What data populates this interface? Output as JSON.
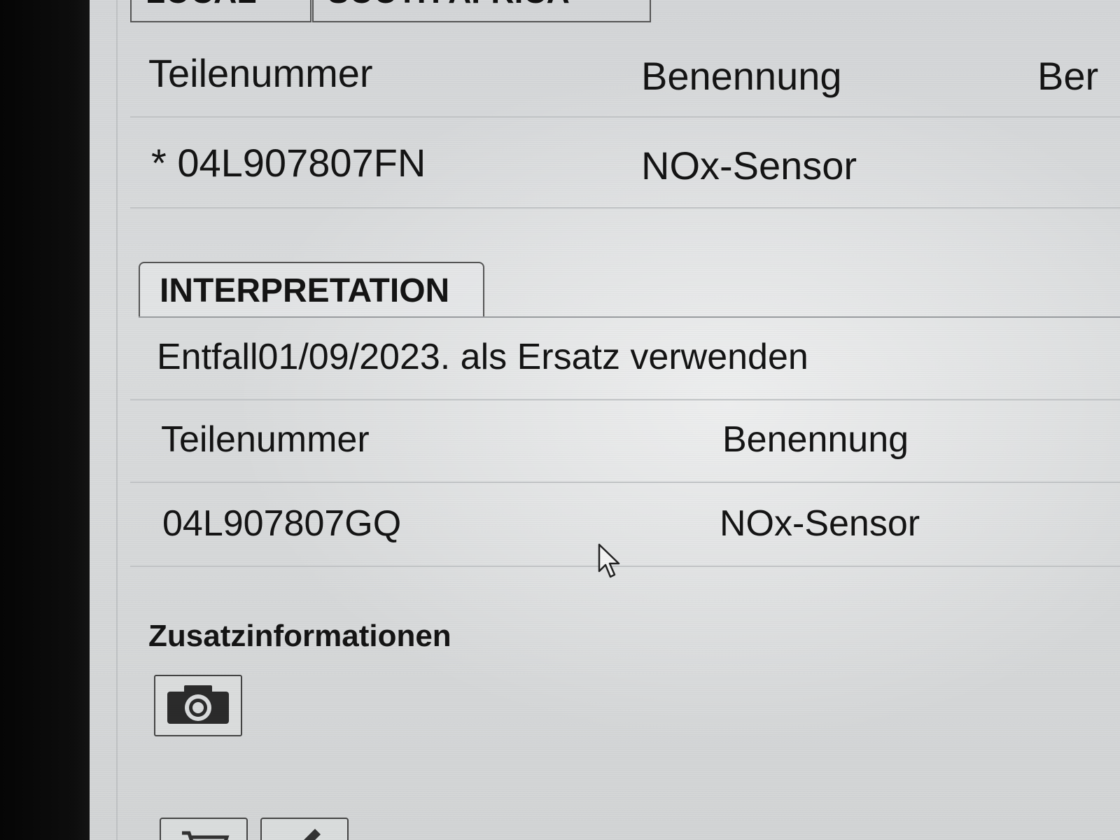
{
  "top_tabs": [
    {
      "label": "LOCAL"
    },
    {
      "label": "SOUTH AFRICA"
    }
  ],
  "parts_table": {
    "headers": [
      "Teilenummer",
      "Benennung",
      "Ber"
    ],
    "rows": [
      {
        "part_number": "* 04L907807FN",
        "name": "NOx-Sensor"
      }
    ]
  },
  "interpretation": {
    "tab_label": "INTERPRETATION",
    "note": "Entfall01/09/2023. als Ersatz verwenden",
    "headers": [
      "Teilenummer",
      "Benennung"
    ],
    "rows": [
      {
        "part_number": "04L907807GQ",
        "name": "NOx-Sensor"
      }
    ]
  },
  "extra_info": {
    "title": "Zusatzinformationen",
    "camera_icon": "camera-icon"
  }
}
